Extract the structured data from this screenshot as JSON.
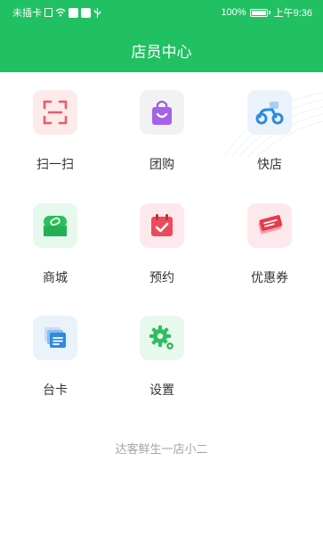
{
  "status_bar": {
    "carrier": "未插卡",
    "battery": "100%",
    "time": "上午9:36"
  },
  "header": {
    "title": "店员中心"
  },
  "menu": [
    {
      "label": "扫一扫",
      "icon": "scan-icon",
      "tile_color": "#fdeaea"
    },
    {
      "label": "团购",
      "icon": "shopping-bag-icon",
      "tile_color": "#f2f2f4"
    },
    {
      "label": "快店",
      "icon": "scooter-icon",
      "tile_color": "#eaf3fb"
    },
    {
      "label": "商城",
      "icon": "store-icon",
      "tile_color": "#e7f8ed"
    },
    {
      "label": "预约",
      "icon": "calendar-check-icon",
      "tile_color": "#fde9ec"
    },
    {
      "label": "优惠券",
      "icon": "coupon-icon",
      "tile_color": "#fde9ec"
    },
    {
      "label": "台卡",
      "icon": "card-stack-icon",
      "tile_color": "#eaf2fb"
    },
    {
      "label": "设置",
      "icon": "gear-icon",
      "tile_color": "#e7f8ed"
    }
  ],
  "footer": {
    "text": "达客鲜生一店小二"
  },
  "colors": {
    "header_bg": "#21c063",
    "label_text": "#333333",
    "footer_text": "#a5a5a5"
  }
}
